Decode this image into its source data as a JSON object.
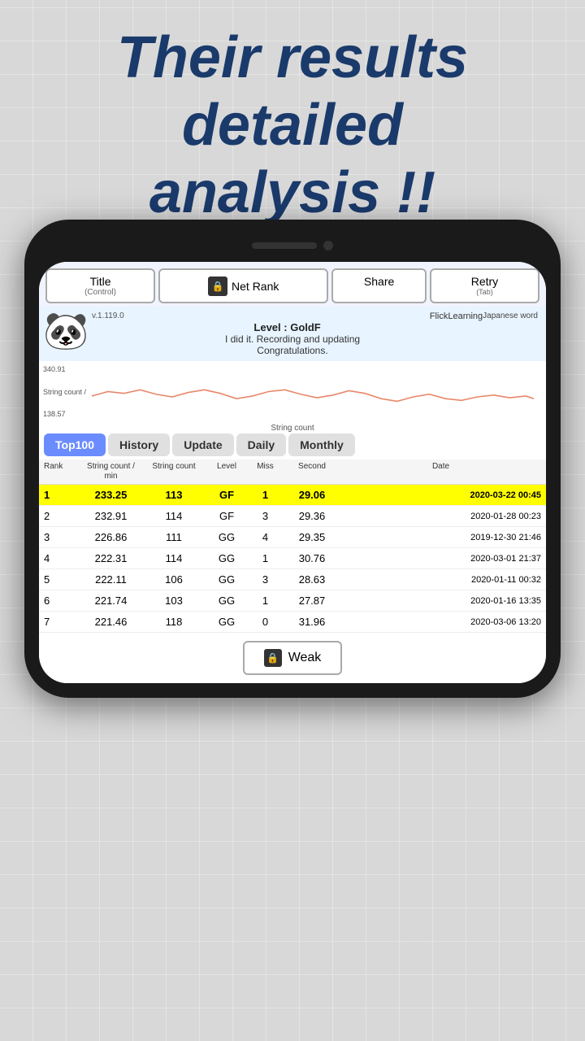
{
  "headline": {
    "line1": "Their results",
    "line2": "detailed",
    "line3": "analysis !!"
  },
  "toolbar": {
    "title_label": "Title",
    "title_sub": "(Control)",
    "netrank_label": "Net Rank",
    "share_label": "Share",
    "retry_label": "Retry",
    "retry_sub": "(Tab)"
  },
  "info": {
    "version": "v.1.119.0",
    "app_name": "FlickLearning",
    "level": "Level : GoldF",
    "message": "I did it. Recording and updating",
    "message2": "Congratulations.",
    "category": "Japanese word",
    "panda_emoji": "🐼"
  },
  "chart": {
    "y_top": "340.91",
    "y_label": "String count /",
    "y_bottom": "138.57",
    "x_label": "String count"
  },
  "tabs": [
    {
      "label": "Top100",
      "active": true
    },
    {
      "label": "History",
      "active": false
    },
    {
      "label": "Update",
      "active": false
    },
    {
      "label": "Daily",
      "active": false
    },
    {
      "label": "Monthly",
      "active": false
    }
  ],
  "table": {
    "headers": {
      "rank": "Rank",
      "string_count_min": "String count / min",
      "string_count": "String count",
      "level": "Level",
      "miss": "Miss",
      "second": "Second",
      "date": "Date"
    },
    "rows": [
      {
        "rank": "1",
        "scm": "233.25",
        "sc": "113",
        "level": "GF",
        "miss": "1",
        "second": "29.06",
        "date": "2020-03-22 00:45",
        "highlight": true
      },
      {
        "rank": "2",
        "scm": "232.91",
        "sc": "114",
        "level": "GF",
        "miss": "3",
        "second": "29.36",
        "date": "2020-01-28 00:23",
        "highlight": false
      },
      {
        "rank": "3",
        "scm": "226.86",
        "sc": "111",
        "level": "GG",
        "miss": "4",
        "second": "29.35",
        "date": "2019-12-30 21:46",
        "highlight": false
      },
      {
        "rank": "4",
        "scm": "222.31",
        "sc": "114",
        "level": "GG",
        "miss": "1",
        "second": "30.76",
        "date": "2020-03-01 21:37",
        "highlight": false
      },
      {
        "rank": "5",
        "scm": "222.11",
        "sc": "106",
        "level": "GG",
        "miss": "3",
        "second": "28.63",
        "date": "2020-01-11 00:32",
        "highlight": false
      },
      {
        "rank": "6",
        "scm": "221.74",
        "sc": "103",
        "level": "GG",
        "miss": "1",
        "second": "27.87",
        "date": "2020-01-16 13:35",
        "highlight": false
      },
      {
        "rank": "7",
        "scm": "221.46",
        "sc": "118",
        "level": "GG",
        "miss": "0",
        "second": "31.96",
        "date": "2020-03-06 13:20",
        "highlight": false
      }
    ]
  },
  "weak_button": {
    "label": "Weak"
  }
}
